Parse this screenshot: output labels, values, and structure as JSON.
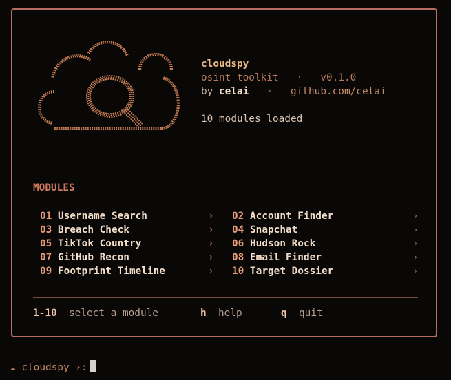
{
  "header": {
    "title": "cloudspy",
    "subtitle": "osint toolkit",
    "separator": "·",
    "version": "v0.1.0",
    "by_prefix": "by",
    "author": "celai",
    "link": "github.com/celai",
    "modules_loaded": "10 modules loaded"
  },
  "section_title": "MODULES",
  "modules": [
    {
      "num": "01",
      "label": "Username Search"
    },
    {
      "num": "02",
      "label": "Account Finder"
    },
    {
      "num": "03",
      "label": "Breach Check"
    },
    {
      "num": "04",
      "label": "Snapchat"
    },
    {
      "num": "05",
      "label": "TikTok Country"
    },
    {
      "num": "06",
      "label": "Hudson Rock"
    },
    {
      "num": "07",
      "label": "GitHub Recon"
    },
    {
      "num": "08",
      "label": "Email Finder"
    },
    {
      "num": "09",
      "label": "Footprint Timeline"
    },
    {
      "num": "10",
      "label": "Target Dossier"
    }
  ],
  "chevron": "›",
  "footer": {
    "range_key": "1-10",
    "range_desc": "select a module",
    "help_key": "h",
    "help_desc": "help",
    "quit_key": "q",
    "quit_desc": "quit"
  },
  "prompt": {
    "icon": "☁",
    "name": "cloudspy",
    "symbol": "›:"
  },
  "colors": {
    "background": "#0a0807",
    "border": "#b86d63",
    "title": "#ebb785",
    "section": "#cf7a5f",
    "module_number": "#e89c79"
  },
  "logo": {
    "icon": "cloud-magnifier-icon"
  }
}
